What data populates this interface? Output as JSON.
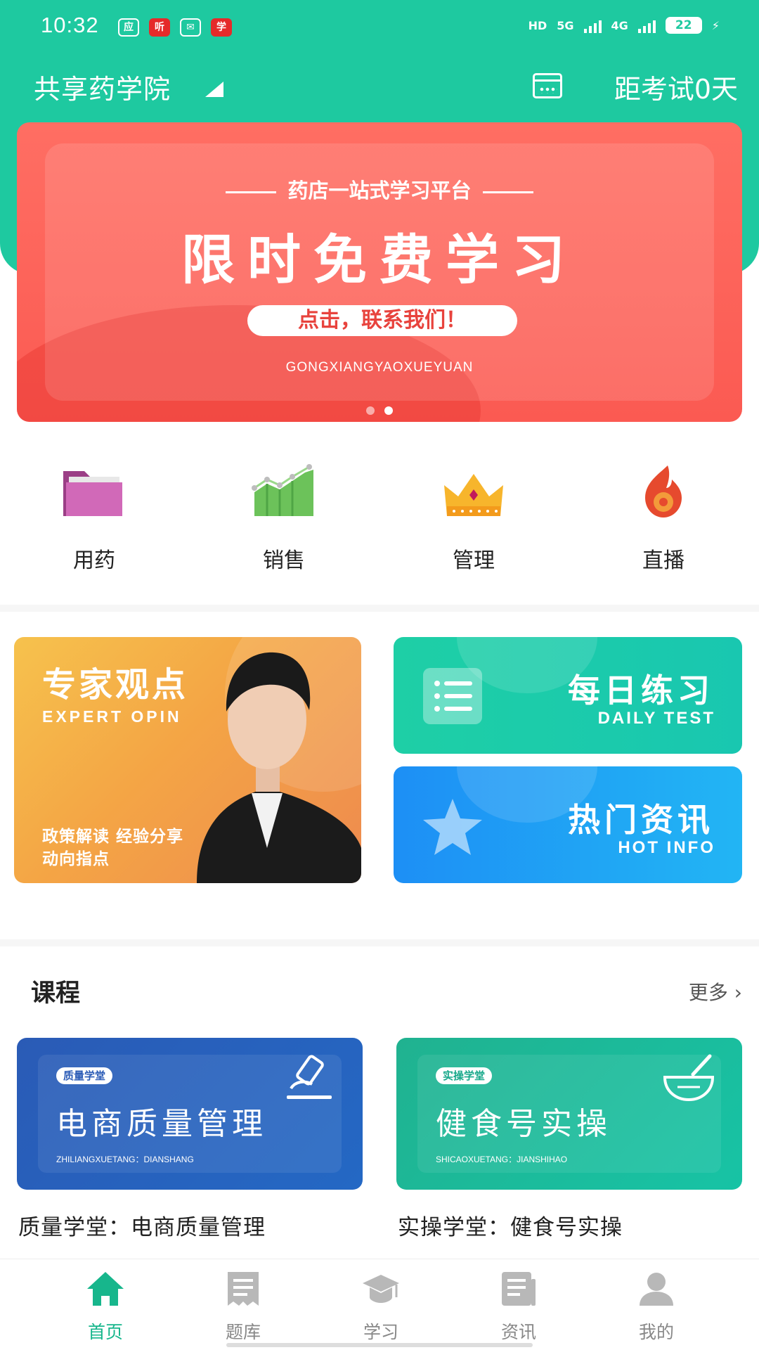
{
  "status_bar": {
    "time": "10:32",
    "app_icons": [
      "应",
      "听",
      "✉",
      "学"
    ],
    "network_1": "HD",
    "network_2": "5G",
    "network_3": "4G",
    "battery": "22"
  },
  "header": {
    "school_name": "共享药学院",
    "countdown": "距考试0天"
  },
  "banner": {
    "subtitle": "药店一站式学习平台",
    "title": "限时免费学习",
    "button": "点击，联系我们！",
    "pinyin": "GONGXIANGYAOXUEYUAN",
    "dot_count": 2,
    "active_dot": 1
  },
  "categories": [
    {
      "label": "用药",
      "icon": "folder-icon"
    },
    {
      "label": "销售",
      "icon": "sales-chart-icon"
    },
    {
      "label": "管理",
      "icon": "crown-icon"
    },
    {
      "label": "直播",
      "icon": "flame-icon"
    }
  ],
  "promo": {
    "expert": {
      "title": "专家观点",
      "subtitle": "EXPERT OPIN",
      "desc_line1": "政策解读  经验分享",
      "desc_line2": "动向指点"
    },
    "daily": {
      "title": "每日练习",
      "subtitle": "DAILY TEST"
    },
    "hot": {
      "title": "热门资讯",
      "subtitle": "HOT INFO"
    }
  },
  "courses": {
    "heading": "课程",
    "more": "更多 ›",
    "items": [
      {
        "tag": "质量学堂",
        "title": "电商质量管理",
        "pinyin": "ZHILIANGXUETANG：DIANSHANG",
        "name": "质量学堂：电商质量管理",
        "icon": "microscope-icon"
      },
      {
        "tag": "实操学堂",
        "title": "健食号实操",
        "pinyin": "SHICAOXUETANG：JIANSHIHAO",
        "name": "实操学堂：健食号实操",
        "icon": "mortar-icon"
      }
    ]
  },
  "tabs": [
    {
      "label": "首页",
      "icon": "home-icon",
      "active": true
    },
    {
      "label": "题库",
      "icon": "question-bank-icon",
      "active": false
    },
    {
      "label": "学习",
      "icon": "graduation-cap-icon",
      "active": false
    },
    {
      "label": "资讯",
      "icon": "news-icon",
      "active": false
    },
    {
      "label": "我的",
      "icon": "profile-icon",
      "active": false
    }
  ],
  "colors": {
    "brand_green": "#1ec9a0",
    "banner_red": "#fb5a52",
    "tab_active": "#17b68c",
    "tab_inactive": "#888888"
  }
}
